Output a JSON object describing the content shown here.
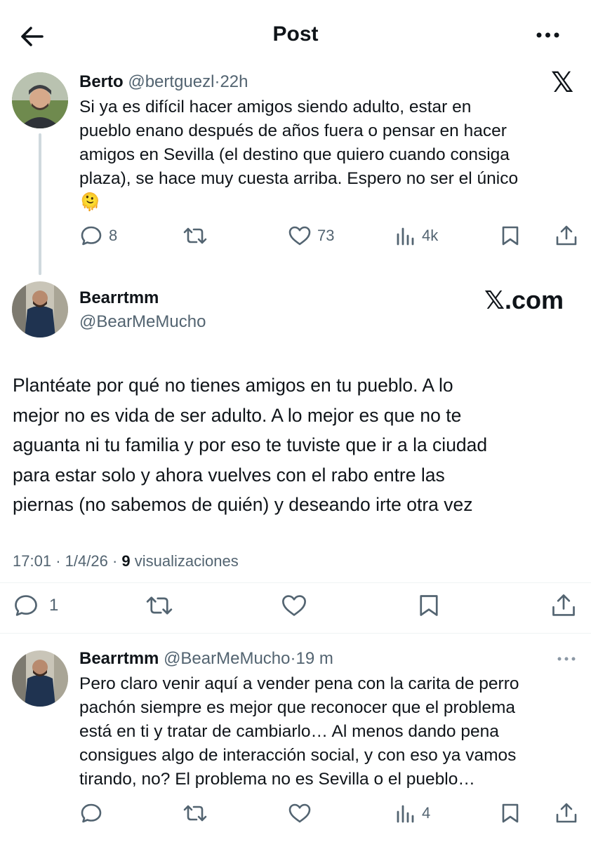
{
  "header": {
    "title": "Post"
  },
  "parent_tweet": {
    "name": "Berto",
    "handle": "@bertguezl",
    "time": "22h",
    "text_lines": [
      "Si ya es difícil hacer amigos siendo adulto, estar en",
      "pueblo enano después de años fuera o pensar en hacer",
      "amigos en Sevilla (el destino que quiero cuando consiga",
      "plaza), se hace muy cuesta arriba.  Espero no ser el único"
    ],
    "emoji": "🫠",
    "replies": "8",
    "likes": "73",
    "views": "4k"
  },
  "main_tweet": {
    "name": "Bearrtmm",
    "handle": "@BearMeMucho",
    "watermark": "𝕏.com",
    "text_lines": [
      "Plantéate por qué no tienes amigos en tu pueblo. A lo",
      "mejor no es vida de ser adulto. A lo mejor es que no te",
      "aguanta ni tu familia y por eso te tuviste que ir a la ciudad",
      "para estar solo y ahora vuelves con el rabo entre las",
      "piernas (no sabemos de quién) y deseando irte otra vez"
    ],
    "time": "17:01",
    "date": "1/4/26",
    "views_count": "9",
    "views_label": "visualizaciones",
    "replies": "1"
  },
  "reply_tweet": {
    "name": "Bearrtmm",
    "handle": "@BearMeMucho",
    "time": "19 m",
    "text_lines": [
      "Pero claro venir aquí a vender pena con la carita de perro",
      "pachón siempre es mejor que reconocer que el problema",
      "está en ti y tratar de cambiarlo… Al menos dando pena",
      "consigues algo de interacción social, y con eso ya vamos",
      "tirando, no? El problema no es Sevilla o el pueblo…"
    ],
    "views": "4"
  },
  "separator": "·",
  "x_logo": "𝕏",
  "colors": {
    "text": "#0f1419",
    "muted": "#536471",
    "divider": "#eff3f4",
    "thread_line": "#cfd9de"
  }
}
